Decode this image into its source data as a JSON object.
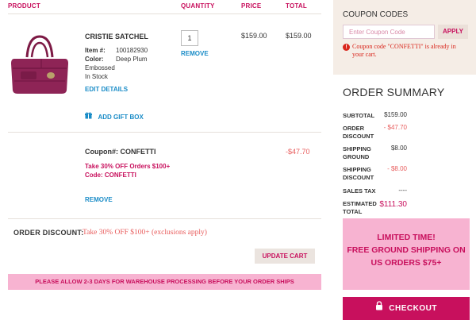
{
  "cart": {
    "headers": {
      "product": "PRODUCT",
      "quantity": "QUANTITY",
      "price": "PRICE",
      "total": "TOTAL"
    },
    "item": {
      "name": "CRISTIE SATCHEL",
      "item_no_label": "Item #:",
      "item_no": "100182930",
      "color_label": "Color:",
      "color_value": "Deep Plum",
      "color_value2": "Embossed",
      "stock": "In Stock",
      "edit_details": "EDIT DETAILS",
      "quantity": "1",
      "remove": "REMOVE",
      "price": "$159.00",
      "total": "$159.00",
      "gift_box": "ADD GIFT BOX"
    },
    "coupon": {
      "label": "Coupon#: CONFETTI",
      "desc_line1": "Take 30% OFF Orders $100+",
      "desc_line2": "Code: CONFETTI",
      "amount": "-$47.70",
      "remove": "REMOVE"
    },
    "order_discount": {
      "label": "ORDER DISCOUNT:",
      "text": "Take 30% OFF $100+ (exclusions apply)"
    },
    "update_cart": "UPDATE CART",
    "notice": "PLEASE ALLOW 2-3 DAYS FOR WAREHOUSE PROCESSING BEFORE YOUR ORDER SHIPS"
  },
  "coupon_codes": {
    "title": "COUPON CODES",
    "placeholder": "Enter Coupon Code",
    "apply": "APPLY",
    "error": "Coupon code \"CONFETTI\" is already in your cart."
  },
  "summary": {
    "title": "ORDER SUMMARY",
    "subtotal_label": "SUBTOTAL",
    "subtotal": "$159.00",
    "order_discount_label1": "ORDER",
    "order_discount_label2": "DISCOUNT",
    "order_discount": "- $47.70",
    "shipping_ground_label1": "SHIPPING",
    "shipping_ground_label2": "GROUND",
    "shipping_ground": "$8.00",
    "shipping_discount_label1": "SHIPPING",
    "shipping_discount_label2": "DISCOUNT",
    "shipping_discount": "- $8.00",
    "sales_tax_label": "SALES TAX",
    "sales_tax": "----",
    "estimated_label1": "ESTIMATED",
    "estimated_label2": "TOTAL",
    "estimated": "$111.30"
  },
  "promo": {
    "line1": "LIMITED TIME!",
    "line2": "FREE GROUND SHIPPING ON",
    "line3": "US ORDERS $75+"
  },
  "checkout": {
    "label": "CHECKOUT"
  },
  "colors": {
    "brand": "#c8105d",
    "link": "#1a8cc7",
    "promo_bg": "#f7b3d1",
    "panel_bg": "#f5ede6"
  }
}
